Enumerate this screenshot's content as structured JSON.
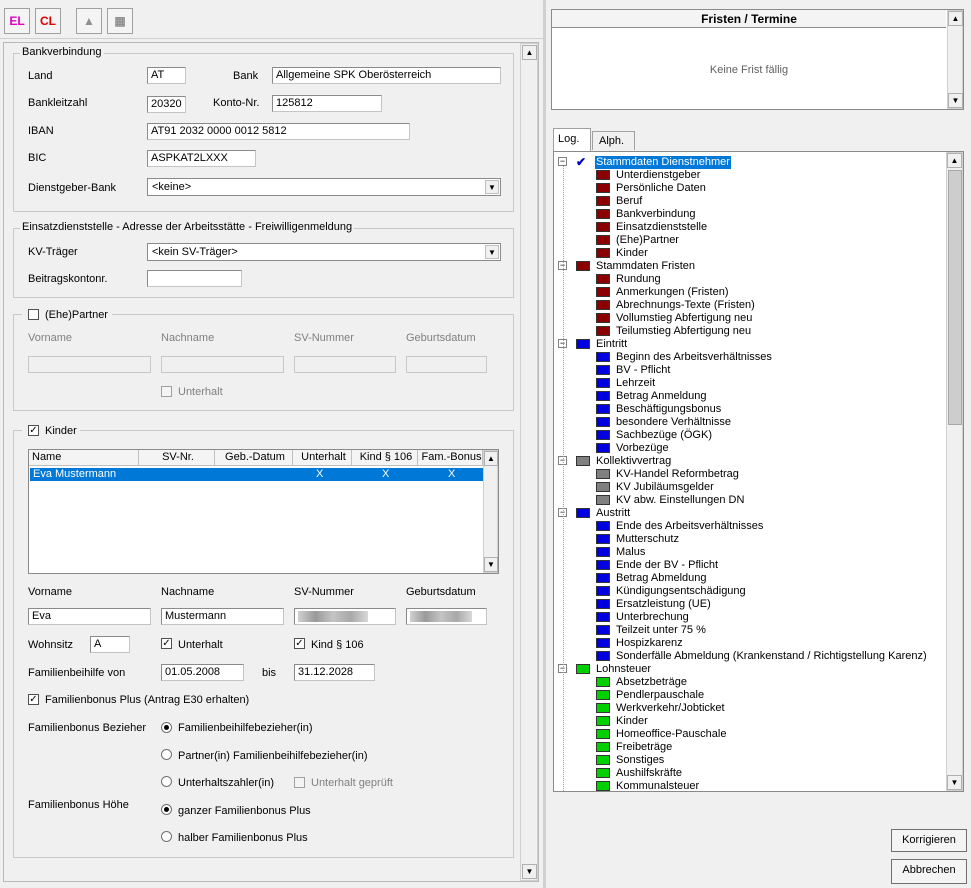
{
  "toolbar": {
    "el": "EL",
    "cl": "CL"
  },
  "bank": {
    "title": "Bankverbindung",
    "land_label": "Land",
    "land": "AT",
    "bank_label": "Bank",
    "bank": "Allgemeine SPK Oberösterreich",
    "blz_label": "Bankleitzahl",
    "blz": "20320",
    "konto_label": "Konto-Nr.",
    "konto": "125812",
    "iban_label": "IBAN",
    "iban": "AT91 2032 0000 0012 5812",
    "bic_label": "BIC",
    "bic": "ASPKAT2LXXX",
    "dgbank_label": "Dienstgeber-Bank",
    "dgbank": "<keine>"
  },
  "einsatz": {
    "title": "Einsatzdienststelle - Adresse der Arbeitsstätte - Freiwilligenmeldung",
    "kv_label": "KV-Träger",
    "kv": "<kein SV-Träger>",
    "beitrag_label": "Beitragskontonr.",
    "beitrag": ""
  },
  "partner": {
    "title": "(Ehe)Partner",
    "vorname": "Vorname",
    "nachname": "Nachname",
    "sv": "SV-Nummer",
    "geb": "Geburtsdatum",
    "unterhalt": "Unterhalt"
  },
  "kinder": {
    "title": "Kinder",
    "columns": [
      "Name",
      "SV-Nr.",
      "Geb.-Datum",
      "Unterhalt",
      "Kind § 106",
      "Fam.-Bonus"
    ],
    "rows": [
      {
        "name": "Eva Mustermann",
        "unterhalt": "X",
        "kind106": "X",
        "bonus": "X"
      }
    ],
    "vorname_label": "Vorname",
    "nachname_label": "Nachname",
    "sv_label": "SV-Nummer",
    "geb_label": "Geburtsdatum",
    "vorname": "Eva",
    "nachname": "Mustermann",
    "wohnsitz_label": "Wohnsitz",
    "wohnsitz": "A",
    "unterhalt_label": "Unterhalt",
    "kind106_label": "Kind § 106",
    "fbh_label": "Familienbeihilfe von",
    "fbh_von": "01.05.2008",
    "bis_label": "bis",
    "fbh_bis": "31.12.2028",
    "fbp_label": "Familienbonus Plus (Antrag E30 erhalten)",
    "bezieher_label": "Familienbonus Bezieher",
    "opt1": "Familienbeihilfebezieher(in)",
    "opt2": "Partner(in) Familienbeihilfebezieher(in)",
    "opt3": "Unterhaltszahler(in)",
    "geprueft": "Unterhalt geprüft",
    "hoehe_label": "Familienbonus Höhe",
    "opt4": "ganzer Familienbonus Plus",
    "opt5": "halber Familienbonus Plus"
  },
  "fristen": {
    "title": "Fristen / Termine",
    "empty": "Keine Frist fällig"
  },
  "tabs": {
    "log": "Log.",
    "alph": "Alph."
  },
  "tree": [
    {
      "t": "Stammdaten Dienstnehmer",
      "lvl": 0,
      "icon": "check-folder",
      "sel": true
    },
    {
      "t": "Unterdienstgeber",
      "lvl": 1,
      "c": "#8b0000"
    },
    {
      "t": "Persönliche Daten",
      "lvl": 1,
      "c": "#8b0000"
    },
    {
      "t": "Beruf",
      "lvl": 1,
      "c": "#8b0000"
    },
    {
      "t": "Bankverbindung",
      "lvl": 1,
      "c": "#8b0000"
    },
    {
      "t": "Einsatzdienststelle",
      "lvl": 1,
      "c": "#8b0000"
    },
    {
      "t": "(Ehe)Partner",
      "lvl": 1,
      "c": "#8b0000"
    },
    {
      "t": "Kinder",
      "lvl": 1,
      "c": "#8b0000"
    },
    {
      "t": "Stammdaten Fristen",
      "lvl": 0,
      "c": "#8b0000"
    },
    {
      "t": "Rundung",
      "lvl": 1,
      "c": "#8b0000"
    },
    {
      "t": "Anmerkungen (Fristen)",
      "lvl": 1,
      "c": "#8b0000"
    },
    {
      "t": "Abrechnungs-Texte (Fristen)",
      "lvl": 1,
      "c": "#8b0000"
    },
    {
      "t": "Vollumstieg Abfertigung neu",
      "lvl": 1,
      "c": "#8b0000"
    },
    {
      "t": "Teilumstieg Abfertigung neu",
      "lvl": 1,
      "c": "#8b0000"
    },
    {
      "t": "Eintritt",
      "lvl": 0,
      "c": "#0000e0"
    },
    {
      "t": "Beginn des Arbeitsverhältnisses",
      "lvl": 1,
      "c": "#0000e0"
    },
    {
      "t": "BV - Pflicht",
      "lvl": 1,
      "c": "#0000e0"
    },
    {
      "t": "Lehrzeit",
      "lvl": 1,
      "c": "#0000e0"
    },
    {
      "t": "Betrag Anmeldung",
      "lvl": 1,
      "c": "#0000e0"
    },
    {
      "t": "Beschäftigungsbonus",
      "lvl": 1,
      "c": "#0000e0"
    },
    {
      "t": "besondere Verhältnisse",
      "lvl": 1,
      "c": "#0000e0"
    },
    {
      "t": "Sachbezüge (ÖGK)",
      "lvl": 1,
      "c": "#0000e0"
    },
    {
      "t": "Vorbezüge",
      "lvl": 1,
      "c": "#0000e0"
    },
    {
      "t": "Kollektivvertrag",
      "lvl": 0,
      "c": "#808080"
    },
    {
      "t": "KV-Handel Reformbetrag",
      "lvl": 1,
      "c": "#808080"
    },
    {
      "t": "KV Jubiläumsgelder",
      "lvl": 1,
      "c": "#808080"
    },
    {
      "t": "KV abw. Einstellungen DN",
      "lvl": 1,
      "c": "#808080"
    },
    {
      "t": "Austritt",
      "lvl": 0,
      "c": "#0000e0"
    },
    {
      "t": "Ende des Arbeitsverhältnisses",
      "lvl": 1,
      "c": "#0000e0"
    },
    {
      "t": "Mutterschutz",
      "lvl": 1,
      "c": "#0000e0"
    },
    {
      "t": "Malus",
      "lvl": 1,
      "c": "#0000e0"
    },
    {
      "t": "Ende der BV - Pflicht",
      "lvl": 1,
      "c": "#0000e0"
    },
    {
      "t": "Betrag Abmeldung",
      "lvl": 1,
      "c": "#0000e0"
    },
    {
      "t": "Kündigungsentschädigung",
      "lvl": 1,
      "c": "#0000e0"
    },
    {
      "t": "Ersatzleistung (UE)",
      "lvl": 1,
      "c": "#0000e0"
    },
    {
      "t": "Unterbrechung",
      "lvl": 1,
      "c": "#0000e0"
    },
    {
      "t": "Teilzeit unter 75 %",
      "lvl": 1,
      "c": "#0000e0"
    },
    {
      "t": "Hospizkarenz",
      "lvl": 1,
      "c": "#0000e0"
    },
    {
      "t": "Sonderfälle Abmeldung (Krankenstand / Richtigstellung Karenz)",
      "lvl": 1,
      "c": "#0000e0"
    },
    {
      "t": "Lohnsteuer",
      "lvl": 0,
      "c": "#00d000"
    },
    {
      "t": "Absetzbeträge",
      "lvl": 1,
      "c": "#00d000"
    },
    {
      "t": "Pendlerpauschale",
      "lvl": 1,
      "c": "#00d000"
    },
    {
      "t": "Werkverkehr/Jobticket",
      "lvl": 1,
      "c": "#00d000"
    },
    {
      "t": "Kinder",
      "lvl": 1,
      "c": "#00d000"
    },
    {
      "t": "Homeoffice-Pauschale",
      "lvl": 1,
      "c": "#00d000"
    },
    {
      "t": "Freibeträge",
      "lvl": 1,
      "c": "#00d000"
    },
    {
      "t": "Sonstiges",
      "lvl": 1,
      "c": "#00d000"
    },
    {
      "t": "Aushilfskräfte",
      "lvl": 1,
      "c": "#00d000"
    },
    {
      "t": "Kommunalsteuer",
      "lvl": 1,
      "c": "#00d000"
    }
  ],
  "buttons": {
    "korrigieren": "Korrigieren",
    "abbrechen": "Abbrechen"
  }
}
